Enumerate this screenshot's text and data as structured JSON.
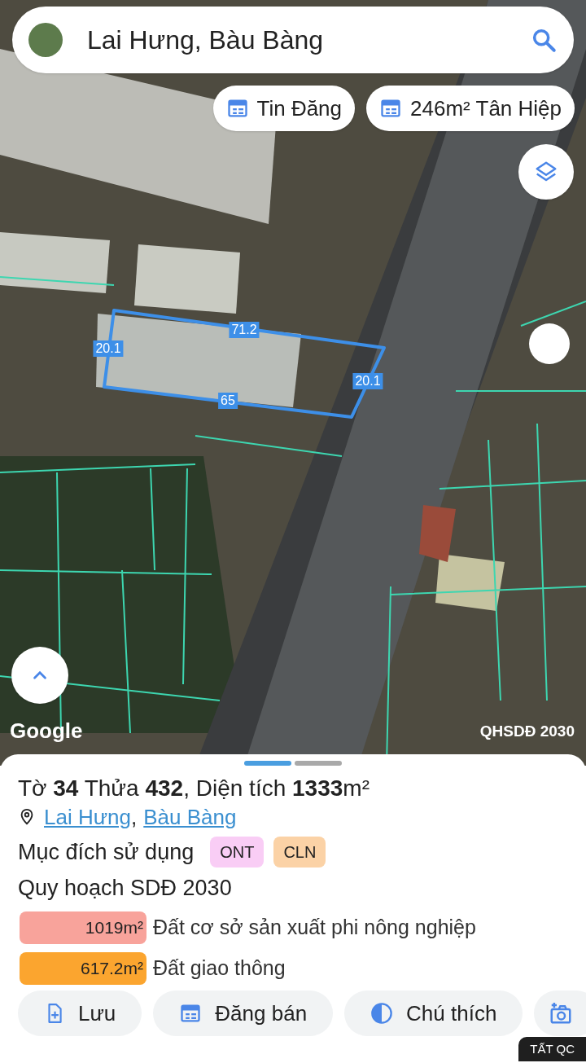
{
  "search": {
    "value": "Lai Hưng, Bàu Bàng"
  },
  "chips": [
    {
      "label": "Tin Đăng"
    },
    {
      "label": "246m² Tân Hiệp"
    }
  ],
  "map": {
    "edge_labels": [
      {
        "text": "71.2"
      },
      {
        "text": "20.1"
      },
      {
        "text": "65"
      },
      {
        "text": "20.1"
      }
    ],
    "attribution": "Google",
    "layer_label": "QHSDĐ 2030"
  },
  "sheet": {
    "pages": [
      {
        "selected": true
      },
      {
        "selected": false
      }
    ],
    "title": "Tờ **34** Thửa **432**, Diện tích **1333**m²",
    "location_links": [
      "Lai Hưng",
      "Bàu Bàng"
    ],
    "location_separator": ",",
    "usage_label": "Mục đích sử dụng",
    "usage_tags": [
      {
        "text": "ONT",
        "color": "#f9cdf5"
      },
      {
        "text": "CLN",
        "color": "#fbd2a6"
      }
    ],
    "plan_title": "Quy hoạch SDĐ 2030",
    "plan_rows": [
      {
        "area": "1019m²",
        "label": "Đất cơ sở sản xuất phi nông nghiệp",
        "color": "#f8a39b"
      },
      {
        "area": "617.2m²",
        "label": "Đất giao thông",
        "color": "#fba52f"
      }
    ],
    "actions": [
      {
        "kind": "save",
        "label": "Lưu"
      },
      {
        "kind": "post",
        "label": "Đăng bán"
      },
      {
        "kind": "legend",
        "label": "Chú thích"
      },
      {
        "kind": "camera"
      }
    ],
    "ad_button": "TẤT QC"
  }
}
